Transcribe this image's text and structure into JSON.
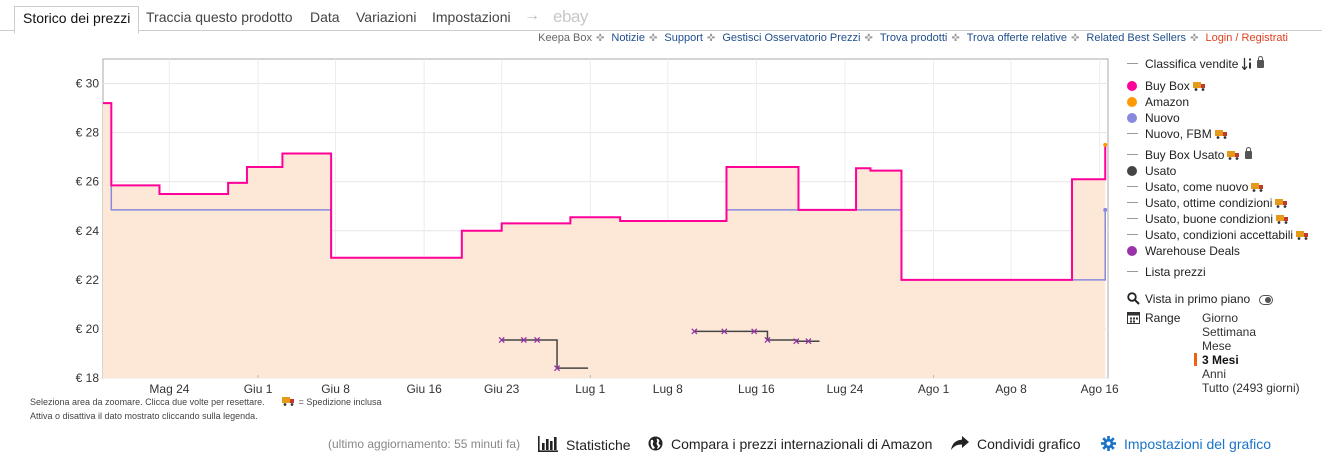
{
  "tabs": [
    {
      "label": "Storico dei prezzi",
      "active": true
    },
    {
      "label": "Traccia questo prodotto"
    },
    {
      "label": "Data"
    },
    {
      "label": "Variazioni"
    },
    {
      "label": "Impostazioni"
    }
  ],
  "tab_arrow": "→",
  "tab_ebay": "ebay",
  "links": {
    "keepa_box": "Keepa Box",
    "notizie": "Notizie",
    "support": "Support",
    "gestisci": "Gestisci Osservatorio Prezzi",
    "trova_prodotti": "Trova prodotti",
    "trova_offerte": "Trova offerte relative",
    "related": "Related Best Sellers",
    "login": "Login / Registrati"
  },
  "notes": {
    "line1": "Seleziona area da zoomare. Clicca due volte per resettare.",
    "shipping": "= Spedizione inclusa",
    "line2": "Attiva o disattiva il dato mostrato cliccando sulla legenda."
  },
  "legend": {
    "items": [
      {
        "label": "Classifica vendite",
        "marker": "line",
        "color": "#999999",
        "extra": "sort-lock"
      },
      {
        "label": "Buy Box",
        "marker": "dot",
        "color": "#ff0099",
        "extra": "truck"
      },
      {
        "label": "Amazon",
        "marker": "dot",
        "color": "#ff9900"
      },
      {
        "label": "Nuovo",
        "marker": "dot",
        "color": "#8888dd"
      },
      {
        "label": "Nuovo, FBM",
        "marker": "line",
        "color": "#999999",
        "extra": "truck"
      },
      {
        "label": "Buy Box Usato",
        "marker": "line",
        "color": "#999999",
        "extra": "truck-lock"
      },
      {
        "label": "Usato",
        "marker": "dot",
        "color": "#444444"
      },
      {
        "label": "Usato, come nuovo",
        "marker": "line",
        "color": "#999999",
        "extra": "truck"
      },
      {
        "label": "Usato, ottime condizioni",
        "marker": "line",
        "color": "#999999",
        "extra": "truck"
      },
      {
        "label": "Usato, buone condizioni",
        "marker": "line",
        "color": "#999999",
        "extra": "truck"
      },
      {
        "label": "Usato, condizioni accettabili",
        "marker": "line",
        "color": "#999999",
        "extra": "truck"
      },
      {
        "label": "Warehouse Deals",
        "marker": "dot",
        "color": "#9933aa"
      },
      {
        "label": "Lista prezzi",
        "marker": "line",
        "color": "#999999"
      }
    ],
    "vista_label": "Vista in primo piano",
    "range_label": "Range",
    "range_options": [
      "Giorno",
      "Settimana",
      "Mese",
      "3 Mesi",
      "Anni",
      "Tutto (2493 giorni)"
    ],
    "range_selected": "3 Mesi"
  },
  "bottom": {
    "updated": "(ultimo aggiornamento: 55 minuti fa)",
    "stats": "Statistiche",
    "compare": "Compara i prezzi internazionali di Amazon",
    "share": "Condividi grafico",
    "settings": "Impostazioni del grafico"
  },
  "chart_data": {
    "type": "line",
    "x_unit": "days since 2024-05-18",
    "xticks": [
      {
        "label": "Mag 24",
        "x": 6
      },
      {
        "label": "Giu 1",
        "x": 14
      },
      {
        "label": "Giu 8",
        "x": 21
      },
      {
        "label": "Giu 16",
        "x": 29
      },
      {
        "label": "Giu 23",
        "x": 36
      },
      {
        "label": "Lug 1",
        "x": 44
      },
      {
        "label": "Lug 8",
        "x": 51
      },
      {
        "label": "Lug 16",
        "x": 59
      },
      {
        "label": "Lug 24",
        "x": 67
      },
      {
        "label": "Ago 1",
        "x": 75
      },
      {
        "label": "Ago 8",
        "x": 82
      },
      {
        "label": "Ago 16",
        "x": 90
      }
    ],
    "ylim": [
      18,
      31
    ],
    "yticks": [
      18,
      20,
      22,
      24,
      26,
      28,
      30
    ],
    "ytick_labels": [
      "€ 18",
      "€ 20",
      "€ 22",
      "€ 24",
      "€ 26",
      "€ 28",
      "€ 30"
    ],
    "xlim": [
      0,
      90.75
    ],
    "grid": true,
    "series": [
      {
        "name": "Nuovo",
        "color": "#8888dd",
        "step": true,
        "points": [
          [
            0,
            29.2
          ],
          [
            0.75,
            24.85
          ],
          [
            20.6,
            22.9
          ],
          [
            32.4,
            24.0
          ],
          [
            36.0,
            24.3
          ],
          [
            42.2,
            24.55
          ],
          [
            46.7,
            24.4
          ],
          [
            56.3,
            24.85
          ],
          [
            65.4,
            24.85
          ],
          [
            72.1,
            22.0
          ],
          [
            90.5,
            24.85
          ]
        ]
      },
      {
        "name": "Buy Box",
        "color": "#ff0099",
        "step": true,
        "fill": "#fde8d7",
        "points": [
          [
            0,
            29.2
          ],
          [
            0.75,
            25.85
          ],
          [
            5.1,
            25.5
          ],
          [
            11.3,
            25.95
          ],
          [
            13.0,
            26.6
          ],
          [
            16.2,
            27.15
          ],
          [
            20.6,
            22.9
          ],
          [
            32.4,
            24.0
          ],
          [
            36.0,
            24.3
          ],
          [
            42.2,
            24.55
          ],
          [
            46.7,
            24.4
          ],
          [
            56.3,
            26.6
          ],
          [
            62.8,
            24.85
          ],
          [
            68.0,
            26.55
          ],
          [
            69.3,
            26.45
          ],
          [
            72.1,
            22.0
          ],
          [
            87.5,
            26.1
          ],
          [
            90.5,
            27.5
          ]
        ]
      },
      {
        "name": "Usato",
        "color": "#444444",
        "step": true,
        "segments": [
          [
            [
              36.0,
              19.55
            ],
            [
              38.0,
              19.55
            ],
            [
              39.2,
              19.55
            ],
            [
              41.0,
              18.4
            ],
            [
              43.8,
              18.4
            ]
          ],
          [
            [
              53.4,
              19.9
            ],
            [
              56.1,
              19.9
            ],
            [
              58.8,
              19.9
            ],
            [
              60.0,
              19.55
            ],
            [
              62.6,
              19.5
            ],
            [
              63.7,
              19.5
            ],
            [
              64.7,
              19.5
            ]
          ]
        ]
      },
      {
        "name": "Warehouse Deals",
        "color": "#9933aa",
        "marker": "x",
        "points": [
          [
            36.0,
            19.55
          ],
          [
            38.0,
            19.55
          ],
          [
            39.2,
            19.55
          ],
          [
            41.0,
            18.4
          ],
          [
            53.4,
            19.9
          ],
          [
            56.1,
            19.9
          ],
          [
            58.8,
            19.9
          ],
          [
            60.0,
            19.55
          ],
          [
            62.6,
            19.5
          ],
          [
            63.7,
            19.5
          ]
        ]
      }
    ]
  }
}
